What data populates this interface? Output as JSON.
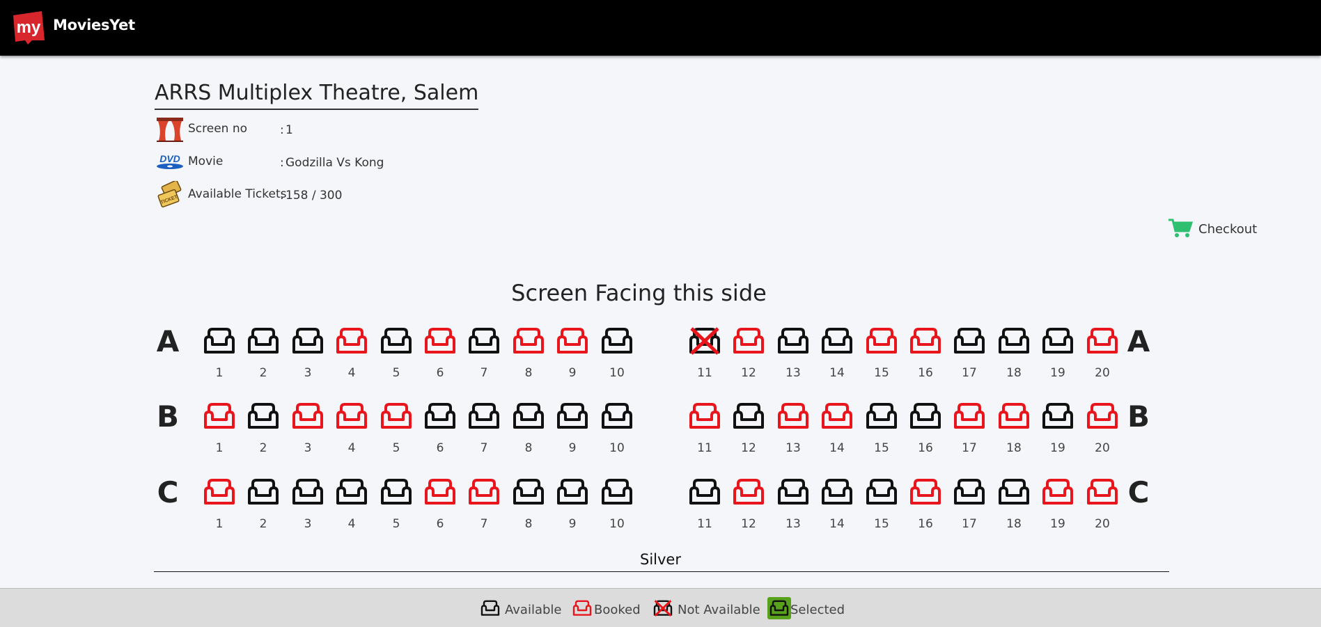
{
  "header": {
    "logo_text": "my",
    "brand": "MoviesYet"
  },
  "theatre": {
    "name": "ARRS Multiplex Theatre, Salem",
    "info": [
      {
        "icon": "curtain-icon",
        "label": "Screen no",
        "value": "1"
      },
      {
        "icon": "dvd-icon",
        "label": "Movie",
        "value": "Godzilla Vs Kong"
      },
      {
        "icon": "ticket-icon",
        "label": "Available Tickets",
        "value": "158 / 300"
      }
    ],
    "colon": ":"
  },
  "checkout": {
    "label": "Checkout",
    "icon": "cart-icon"
  },
  "screen_label": "Screen Facing this side",
  "colors": {
    "available": "#111111",
    "booked": "#e8161c",
    "not_available_cross": "#e8161c",
    "selected_bg": "#58a11a",
    "cart": "#2fbf71"
  },
  "seating": {
    "section": "Silver",
    "rows": [
      {
        "label": "A",
        "seats": [
          {
            "n": "1",
            "s": "available"
          },
          {
            "n": "2",
            "s": "available"
          },
          {
            "n": "3",
            "s": "available"
          },
          {
            "n": "4",
            "s": "booked"
          },
          {
            "n": "5",
            "s": "available"
          },
          {
            "n": "6",
            "s": "booked"
          },
          {
            "n": "7",
            "s": "available"
          },
          {
            "n": "8",
            "s": "booked"
          },
          {
            "n": "9",
            "s": "booked"
          },
          {
            "n": "10",
            "s": "available"
          },
          {
            "n": "11",
            "s": "not-available"
          },
          {
            "n": "12",
            "s": "booked"
          },
          {
            "n": "13",
            "s": "available"
          },
          {
            "n": "14",
            "s": "available"
          },
          {
            "n": "15",
            "s": "booked"
          },
          {
            "n": "16",
            "s": "booked"
          },
          {
            "n": "17",
            "s": "available"
          },
          {
            "n": "18",
            "s": "available"
          },
          {
            "n": "19",
            "s": "available"
          },
          {
            "n": "20",
            "s": "booked"
          }
        ]
      },
      {
        "label": "B",
        "seats": [
          {
            "n": "1",
            "s": "booked"
          },
          {
            "n": "2",
            "s": "available"
          },
          {
            "n": "3",
            "s": "booked"
          },
          {
            "n": "4",
            "s": "booked"
          },
          {
            "n": "5",
            "s": "booked"
          },
          {
            "n": "6",
            "s": "available"
          },
          {
            "n": "7",
            "s": "available"
          },
          {
            "n": "8",
            "s": "available"
          },
          {
            "n": "9",
            "s": "available"
          },
          {
            "n": "10",
            "s": "available"
          },
          {
            "n": "11",
            "s": "booked"
          },
          {
            "n": "12",
            "s": "available"
          },
          {
            "n": "13",
            "s": "booked"
          },
          {
            "n": "14",
            "s": "booked"
          },
          {
            "n": "15",
            "s": "available"
          },
          {
            "n": "16",
            "s": "available"
          },
          {
            "n": "17",
            "s": "booked"
          },
          {
            "n": "18",
            "s": "booked"
          },
          {
            "n": "19",
            "s": "available"
          },
          {
            "n": "20",
            "s": "booked"
          }
        ]
      },
      {
        "label": "C",
        "seats": [
          {
            "n": "1",
            "s": "booked"
          },
          {
            "n": "2",
            "s": "available"
          },
          {
            "n": "3",
            "s": "available"
          },
          {
            "n": "4",
            "s": "available"
          },
          {
            "n": "5",
            "s": "available"
          },
          {
            "n": "6",
            "s": "booked"
          },
          {
            "n": "7",
            "s": "booked"
          },
          {
            "n": "8",
            "s": "available"
          },
          {
            "n": "9",
            "s": "available"
          },
          {
            "n": "10",
            "s": "available"
          },
          {
            "n": "11",
            "s": "available"
          },
          {
            "n": "12",
            "s": "booked"
          },
          {
            "n": "13",
            "s": "available"
          },
          {
            "n": "14",
            "s": "available"
          },
          {
            "n": "15",
            "s": "available"
          },
          {
            "n": "16",
            "s": "booked"
          },
          {
            "n": "17",
            "s": "available"
          },
          {
            "n": "18",
            "s": "available"
          },
          {
            "n": "19",
            "s": "booked"
          },
          {
            "n": "20",
            "s": "booked"
          }
        ]
      }
    ]
  },
  "legend": [
    {
      "label": "Available",
      "state": "available"
    },
    {
      "label": "Booked",
      "state": "booked"
    },
    {
      "label": "Not Available",
      "state": "not-available"
    },
    {
      "label": "Selected",
      "state": "selected"
    }
  ]
}
